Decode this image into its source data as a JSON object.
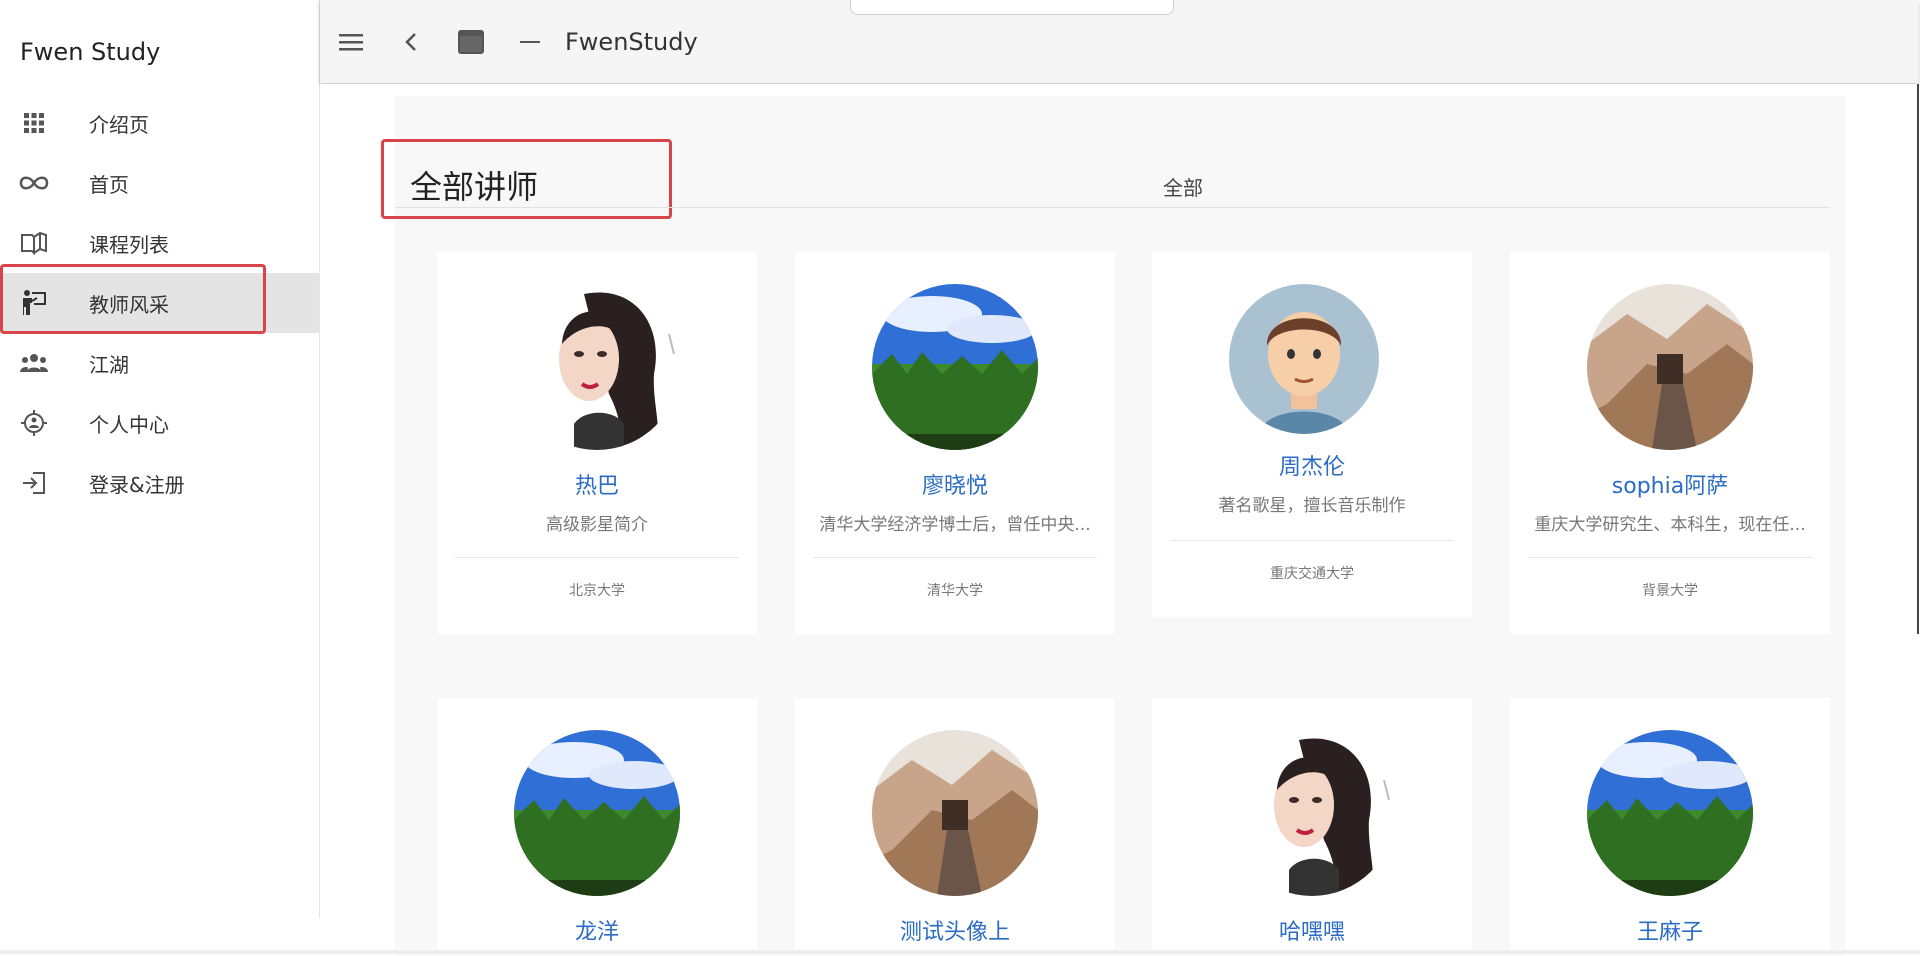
{
  "app": {
    "title": "Fwen Study"
  },
  "sidebar": {
    "items": [
      {
        "label": "介绍页",
        "icon": "grid-icon"
      },
      {
        "label": "首页",
        "icon": "infinity-icon"
      },
      {
        "label": "课程列表",
        "icon": "book-open-icon"
      },
      {
        "label": "教师风采",
        "icon": "teacher-icon",
        "active": true
      },
      {
        "label": "江湖",
        "icon": "people-icon"
      },
      {
        "label": "个人中心",
        "icon": "crosshair-person-icon"
      },
      {
        "label": "登录&注册",
        "icon": "login-icon"
      }
    ]
  },
  "appbar": {
    "title": "FwenStudy",
    "icons": [
      "menu-icon",
      "back-icon",
      "window-icon",
      "minimize-icon"
    ]
  },
  "main": {
    "section_title": "全部讲师",
    "filter_label": "全部",
    "teachers": [
      {
        "name": "热巴",
        "desc": "高级影星简介",
        "school": "北京大学",
        "avatar": "woman"
      },
      {
        "name": "廖晓悦",
        "desc": "清华大学经济学博士后，曾任中央...",
        "school": "清华大学",
        "avatar": "forest"
      },
      {
        "name": "周杰伦",
        "desc": "著名歌星，擅长音乐制作",
        "school": "重庆交通大学",
        "avatar": "cartoon-man"
      },
      {
        "name": "sophia阿萨",
        "desc": "重庆大学研究生、本科生，现在任...",
        "school": "背景大学",
        "avatar": "road"
      },
      {
        "name": "龙洋",
        "avatar": "forest"
      },
      {
        "name": "测试头像上",
        "avatar": "road"
      },
      {
        "name": "哈嘿嘿",
        "avatar": "woman"
      },
      {
        "name": "王麻子",
        "avatar": "forest"
      }
    ]
  },
  "colors": {
    "accent_link": "#2b6cc4",
    "highlight_border": "#d9434a",
    "active_nav_bg": "#e4e4e4"
  }
}
